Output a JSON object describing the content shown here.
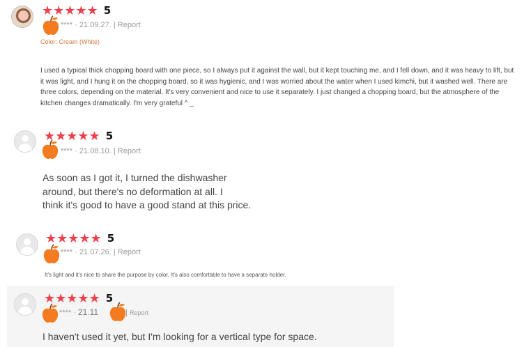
{
  "reviews": [
    {
      "stars": "★★★★★",
      "score": "5",
      "user": "****",
      "date": "21.09.27.",
      "report": "Report",
      "option": "Color: Cream (White)",
      "text": "I used a typical thick chopping board with one piece, so I always put it against the wall, but it kept touching me, and I fell down, and it was heavy to lift, but it was light, and I hung it on the chopping board, so it was hygienic, and I was worried about the water when I used kimchi, but it washed well. There are three colors, depending on the material. It's very convenient and nice to use it separately. I just changed a chopping board, but the atmosphere of the kitchen changes dramatically. I'm very grateful ^ _"
    },
    {
      "stars": "★★★★★",
      "score": "5",
      "user": "****",
      "date": "21.08.10.",
      "report": "Report",
      "text_lines": [
        "As soon as I got it, I turned the dishwasher",
        "around, but there's no deformation at all. I",
        "think it's good to have a good stand at this price."
      ]
    },
    {
      "stars": "★★★★★",
      "score": "5",
      "user": "****",
      "date": "21.07.26.",
      "report": "Report",
      "text": "It's light and it's nice to share the purpose by color. It's also comfortable to have a separate holder."
    },
    {
      "stars": "★★★★★",
      "score": "5",
      "user": "****",
      "date": "21.11",
      "report": "Report",
      "text": "I haven't used it yet, but I'm looking for a vertical type for space."
    }
  ],
  "colors": {
    "star": "#ef3f4a",
    "apple": "#f47b20",
    "option": "#d07a43",
    "highlight": "#f5f5f5"
  }
}
